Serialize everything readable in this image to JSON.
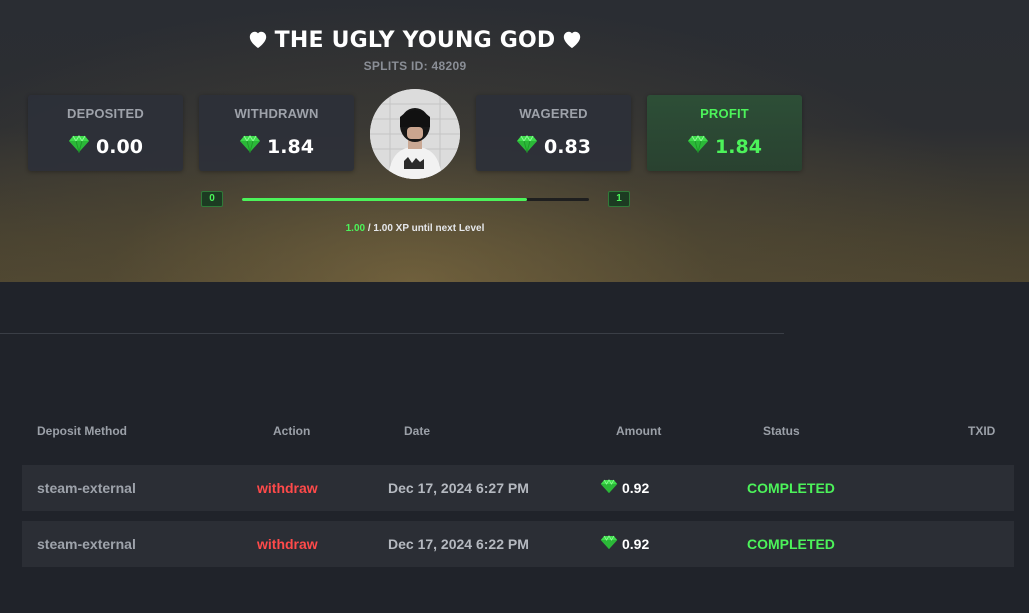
{
  "profile": {
    "name": "THE UGLY YOUNG GOD",
    "splits_id": "SPLITS ID: 48209",
    "heart_icon": "heart-icon"
  },
  "stats": [
    {
      "label": "DEPOSITED",
      "value": "0.00",
      "icon": "gem-icon"
    },
    {
      "label": "WITHDRAWN",
      "value": "1.84",
      "icon": "gem-icon"
    },
    {
      "label": "WAGERED",
      "value": "0.83",
      "icon": "gem-icon"
    },
    {
      "label": "PROFIT",
      "value": "1.84",
      "icon": "gem-icon"
    }
  ],
  "level": {
    "current_level": "0",
    "next_level": "1",
    "progress_fraction": 0.82,
    "xp_current": "1.00",
    "xp_rest": " / 1.00 XP until next Level"
  },
  "table": {
    "headers": [
      "Deposit Method",
      "Action",
      "Date",
      "Amount",
      "Status",
      "TXID"
    ],
    "rows": [
      {
        "method": "steam-external",
        "action": "withdraw",
        "date": "Dec 17, 2024 6:27 PM",
        "amount": "0.92",
        "status": "COMPLETED",
        "txid": ""
      },
      {
        "method": "steam-external",
        "action": "withdraw",
        "date": "Dec 17, 2024 6:22 PM",
        "amount": "0.92",
        "status": "COMPLETED",
        "txid": ""
      }
    ]
  },
  "colors": {
    "accent_green": "#4cf35a",
    "withdraw_red": "#ff4a4a",
    "background": "#20232a"
  }
}
